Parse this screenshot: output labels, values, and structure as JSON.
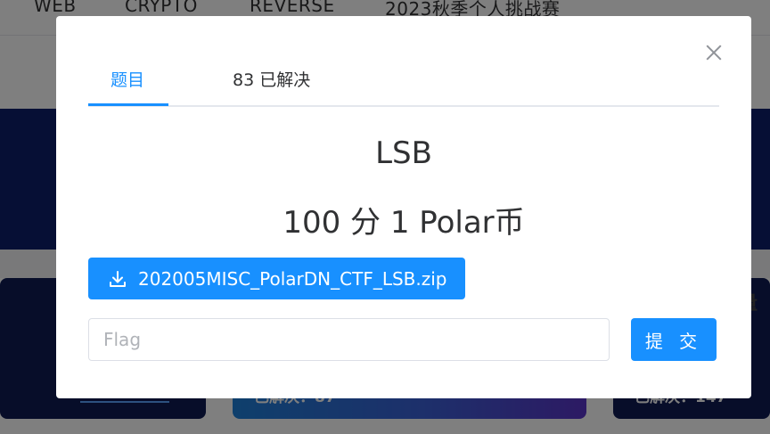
{
  "nav": {
    "items": [
      "WEB",
      "CRYPTO",
      "REVERSE",
      "2023秋季个人挑战赛"
    ]
  },
  "background": {
    "card2_solved": "已解决：87",
    "card3_solved": "已解决：147",
    "card3_title_fragment": "流量"
  },
  "dialog": {
    "tabs": [
      {
        "label": "题目"
      },
      {
        "label": "83 已解决"
      }
    ],
    "title": "LSB",
    "score": "100 分 1 Polar币",
    "download_label": "202005MISC_PolarDN_CTF_LSB.zip",
    "flag_placeholder": "Flag",
    "flag_value": "",
    "submit_label": "提 交",
    "icons": [
      "close-icon",
      "download-icon"
    ],
    "accent_color": "#1890ff"
  }
}
